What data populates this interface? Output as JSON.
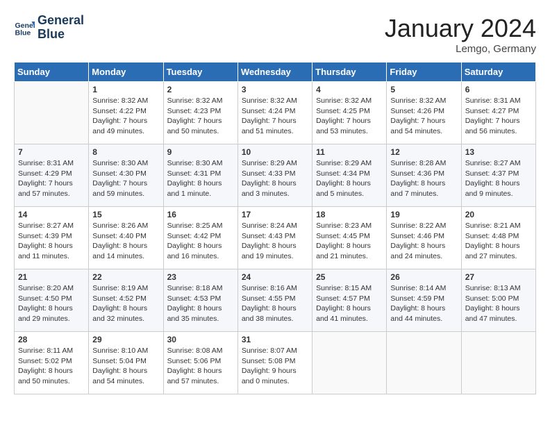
{
  "header": {
    "logo_line1": "General",
    "logo_line2": "Blue",
    "month": "January 2024",
    "location": "Lemgo, Germany"
  },
  "weekdays": [
    "Sunday",
    "Monday",
    "Tuesday",
    "Wednesday",
    "Thursday",
    "Friday",
    "Saturday"
  ],
  "weeks": [
    [
      {
        "day": "",
        "sunrise": "",
        "sunset": "",
        "daylight": ""
      },
      {
        "day": "1",
        "sunrise": "Sunrise: 8:32 AM",
        "sunset": "Sunset: 4:22 PM",
        "daylight": "Daylight: 7 hours and 49 minutes."
      },
      {
        "day": "2",
        "sunrise": "Sunrise: 8:32 AM",
        "sunset": "Sunset: 4:23 PM",
        "daylight": "Daylight: 7 hours and 50 minutes."
      },
      {
        "day": "3",
        "sunrise": "Sunrise: 8:32 AM",
        "sunset": "Sunset: 4:24 PM",
        "daylight": "Daylight: 7 hours and 51 minutes."
      },
      {
        "day": "4",
        "sunrise": "Sunrise: 8:32 AM",
        "sunset": "Sunset: 4:25 PM",
        "daylight": "Daylight: 7 hours and 53 minutes."
      },
      {
        "day": "5",
        "sunrise": "Sunrise: 8:32 AM",
        "sunset": "Sunset: 4:26 PM",
        "daylight": "Daylight: 7 hours and 54 minutes."
      },
      {
        "day": "6",
        "sunrise": "Sunrise: 8:31 AM",
        "sunset": "Sunset: 4:27 PM",
        "daylight": "Daylight: 7 hours and 56 minutes."
      }
    ],
    [
      {
        "day": "7",
        "sunrise": "Sunrise: 8:31 AM",
        "sunset": "Sunset: 4:29 PM",
        "daylight": "Daylight: 7 hours and 57 minutes."
      },
      {
        "day": "8",
        "sunrise": "Sunrise: 8:30 AM",
        "sunset": "Sunset: 4:30 PM",
        "daylight": "Daylight: 7 hours and 59 minutes."
      },
      {
        "day": "9",
        "sunrise": "Sunrise: 8:30 AM",
        "sunset": "Sunset: 4:31 PM",
        "daylight": "Daylight: 8 hours and 1 minute."
      },
      {
        "day": "10",
        "sunrise": "Sunrise: 8:29 AM",
        "sunset": "Sunset: 4:33 PM",
        "daylight": "Daylight: 8 hours and 3 minutes."
      },
      {
        "day": "11",
        "sunrise": "Sunrise: 8:29 AM",
        "sunset": "Sunset: 4:34 PM",
        "daylight": "Daylight: 8 hours and 5 minutes."
      },
      {
        "day": "12",
        "sunrise": "Sunrise: 8:28 AM",
        "sunset": "Sunset: 4:36 PM",
        "daylight": "Daylight: 8 hours and 7 minutes."
      },
      {
        "day": "13",
        "sunrise": "Sunrise: 8:27 AM",
        "sunset": "Sunset: 4:37 PM",
        "daylight": "Daylight: 8 hours and 9 minutes."
      }
    ],
    [
      {
        "day": "14",
        "sunrise": "Sunrise: 8:27 AM",
        "sunset": "Sunset: 4:39 PM",
        "daylight": "Daylight: 8 hours and 11 minutes."
      },
      {
        "day": "15",
        "sunrise": "Sunrise: 8:26 AM",
        "sunset": "Sunset: 4:40 PM",
        "daylight": "Daylight: 8 hours and 14 minutes."
      },
      {
        "day": "16",
        "sunrise": "Sunrise: 8:25 AM",
        "sunset": "Sunset: 4:42 PM",
        "daylight": "Daylight: 8 hours and 16 minutes."
      },
      {
        "day": "17",
        "sunrise": "Sunrise: 8:24 AM",
        "sunset": "Sunset: 4:43 PM",
        "daylight": "Daylight: 8 hours and 19 minutes."
      },
      {
        "day": "18",
        "sunrise": "Sunrise: 8:23 AM",
        "sunset": "Sunset: 4:45 PM",
        "daylight": "Daylight: 8 hours and 21 minutes."
      },
      {
        "day": "19",
        "sunrise": "Sunrise: 8:22 AM",
        "sunset": "Sunset: 4:46 PM",
        "daylight": "Daylight: 8 hours and 24 minutes."
      },
      {
        "day": "20",
        "sunrise": "Sunrise: 8:21 AM",
        "sunset": "Sunset: 4:48 PM",
        "daylight": "Daylight: 8 hours and 27 minutes."
      }
    ],
    [
      {
        "day": "21",
        "sunrise": "Sunrise: 8:20 AM",
        "sunset": "Sunset: 4:50 PM",
        "daylight": "Daylight: 8 hours and 29 minutes."
      },
      {
        "day": "22",
        "sunrise": "Sunrise: 8:19 AM",
        "sunset": "Sunset: 4:52 PM",
        "daylight": "Daylight: 8 hours and 32 minutes."
      },
      {
        "day": "23",
        "sunrise": "Sunrise: 8:18 AM",
        "sunset": "Sunset: 4:53 PM",
        "daylight": "Daylight: 8 hours and 35 minutes."
      },
      {
        "day": "24",
        "sunrise": "Sunrise: 8:16 AM",
        "sunset": "Sunset: 4:55 PM",
        "daylight": "Daylight: 8 hours and 38 minutes."
      },
      {
        "day": "25",
        "sunrise": "Sunrise: 8:15 AM",
        "sunset": "Sunset: 4:57 PM",
        "daylight": "Daylight: 8 hours and 41 minutes."
      },
      {
        "day": "26",
        "sunrise": "Sunrise: 8:14 AM",
        "sunset": "Sunset: 4:59 PM",
        "daylight": "Daylight: 8 hours and 44 minutes."
      },
      {
        "day": "27",
        "sunrise": "Sunrise: 8:13 AM",
        "sunset": "Sunset: 5:00 PM",
        "daylight": "Daylight: 8 hours and 47 minutes."
      }
    ],
    [
      {
        "day": "28",
        "sunrise": "Sunrise: 8:11 AM",
        "sunset": "Sunset: 5:02 PM",
        "daylight": "Daylight: 8 hours and 50 minutes."
      },
      {
        "day": "29",
        "sunrise": "Sunrise: 8:10 AM",
        "sunset": "Sunset: 5:04 PM",
        "daylight": "Daylight: 8 hours and 54 minutes."
      },
      {
        "day": "30",
        "sunrise": "Sunrise: 8:08 AM",
        "sunset": "Sunset: 5:06 PM",
        "daylight": "Daylight: 8 hours and 57 minutes."
      },
      {
        "day": "31",
        "sunrise": "Sunrise: 8:07 AM",
        "sunset": "Sunset: 5:08 PM",
        "daylight": "Daylight: 9 hours and 0 minutes."
      },
      {
        "day": "",
        "sunrise": "",
        "sunset": "",
        "daylight": ""
      },
      {
        "day": "",
        "sunrise": "",
        "sunset": "",
        "daylight": ""
      },
      {
        "day": "",
        "sunrise": "",
        "sunset": "",
        "daylight": ""
      }
    ]
  ]
}
